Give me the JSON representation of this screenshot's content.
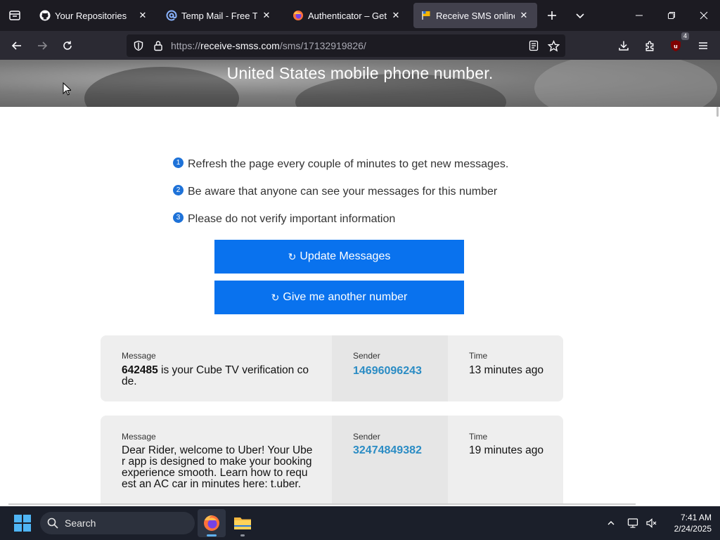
{
  "browser": {
    "tabs": [
      {
        "title": "Your Repositories",
        "active": false
      },
      {
        "title": "Temp Mail - Free Temp",
        "active": false
      },
      {
        "title": "Authenticator – Get this",
        "active": false
      },
      {
        "title": "Receive SMS online | Te",
        "active": true
      }
    ],
    "url": {
      "prefix": "https://",
      "domain": "receive-smss.com",
      "path": "/sms/17132919826/"
    },
    "extension_badge": "4"
  },
  "page": {
    "hero_title": "United States mobile phone number.",
    "tips": [
      {
        "num": "1",
        "text": "Refresh the page every couple of minutes to get new messages."
      },
      {
        "num": "2",
        "text": "Be aware that anyone can see your messages for this number"
      },
      {
        "num": "3",
        "text": "Please do not verify important information"
      }
    ],
    "buttons": {
      "update_symbol": "↻",
      "update_label": "Update Messages",
      "another_symbol": "↻",
      "another_label": "Give me another number"
    },
    "messages_labels": {
      "message": "Message",
      "sender": "Sender",
      "time": "Time"
    },
    "messages": [
      {
        "code": "642485",
        "text": " is your Cube TV verification code.",
        "sender": "14696096243",
        "time": "13 minutes ago"
      },
      {
        "code": "",
        "text": "Dear Rider, welcome to Uber! Your Uber app is designed to make your booking experience smooth. Learn how to request an AC car in minutes here: t.uber.",
        "sender": "32474849382",
        "time": "19 minutes ago"
      }
    ]
  },
  "taskbar": {
    "search_placeholder": "Search",
    "time": "7:41 AM",
    "date": "2/24/2025"
  }
}
